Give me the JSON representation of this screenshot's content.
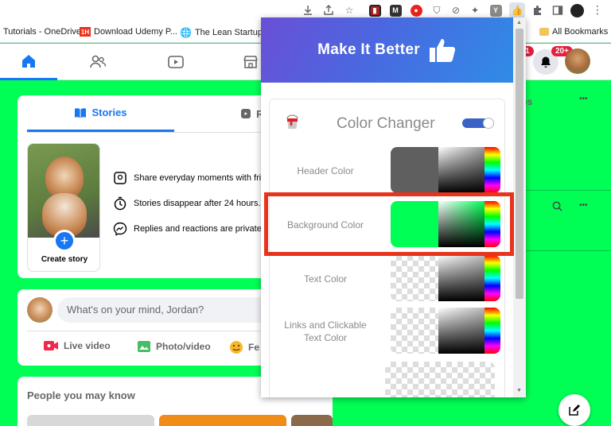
{
  "bookmarks": {
    "items": [
      {
        "label": "Tutorials - OneDrive"
      },
      {
        "label": "Download Udemy P..."
      },
      {
        "label": "The Lean Startup: H..."
      }
    ],
    "all_bookmarks": "All Bookmarks",
    "udemy_badge": "1H"
  },
  "extensions": {
    "icons": [
      "download-icon",
      "share-icon",
      "star-icon",
      "red-ext-icon",
      "mail-ext-icon",
      "red-drop-icon",
      "shield-ext-icon",
      "dash-circle-icon",
      "tool-ext-icon",
      "y-ext-icon",
      "thumb-ext-icon",
      "puzzle-icon",
      "sidepanel-icon",
      "profile-icon",
      "menu-icon"
    ],
    "y_label": "Y",
    "m_label": "M"
  },
  "nav": {
    "notif_count_1": "1",
    "notif_count_2": "20+"
  },
  "stories": {
    "tab_stories": "Stories",
    "tab_reels": "Ree",
    "create_story": "Create story",
    "features": [
      "Share everyday moments with frie",
      "Stories disappear after 24 hours.",
      "Replies and reactions are private."
    ]
  },
  "composer": {
    "placeholder": "What's on your mind, Jordan?",
    "live_video": "Live video",
    "photo_video": "Photo/video",
    "feeling": "Fe"
  },
  "people": {
    "title": "People you may know"
  },
  "right_col": {
    "section_suffix": "es",
    "more": "•••"
  },
  "popup": {
    "title": "Make It Better",
    "section_title": "Color Changer",
    "toggle_on": true,
    "rows": [
      {
        "label": "Header Color",
        "solid": "#5f5f5f"
      },
      {
        "label": "Background Color",
        "solid": "#00ff55"
      },
      {
        "label": "Text Color",
        "solid": "checker"
      },
      {
        "label_line1": "Links and Clickable",
        "label_line2": "Text Color",
        "solid": "checker"
      }
    ]
  },
  "colors": {
    "fb_blue": "#1877f2",
    "page_bg": "#00ff55",
    "highlight": "#e8341c"
  }
}
